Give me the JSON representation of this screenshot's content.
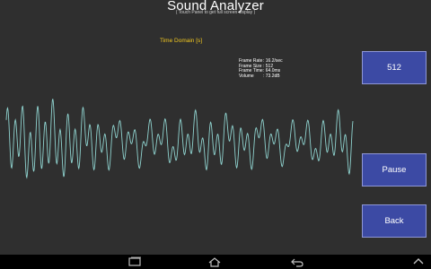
{
  "header": {
    "title": "Sound Analyzer",
    "subtitle": "( Touch Panel to get full screen display )"
  },
  "graph": {
    "domain_label": "Time Domain [s]",
    "wave_color": "#8fd3cf"
  },
  "stats": [
    {
      "label": "Frame Rate",
      "value": ": 16.2/sec"
    },
    {
      "label": "Frame Size",
      "value": ": 512"
    },
    {
      "label": "Frame Time",
      "value": ": 64.0ms"
    },
    {
      "label": "Volume",
      "value": ": 73.2dB"
    }
  ],
  "buttons": {
    "frame_size_label": "512",
    "pause_label": "Pause",
    "back_label": "Back"
  },
  "navbar": {
    "icons": [
      "recent-apps-icon",
      "home-icon",
      "back-icon",
      "chevron-up-icon"
    ]
  },
  "colors": {
    "background": "#2f2f2f",
    "button_fill": "#3c4aa4",
    "button_border": "#8f97d6",
    "label_yellow": "#f2c820"
  }
}
